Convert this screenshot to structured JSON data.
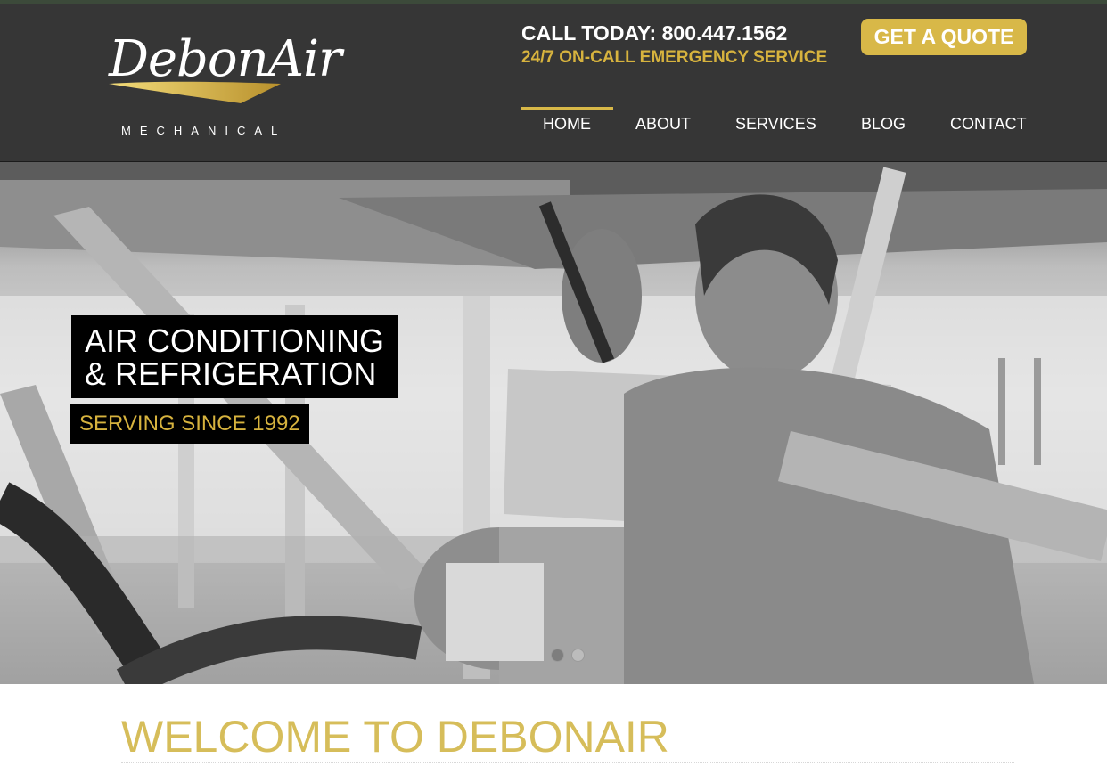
{
  "brand": {
    "logo_word": "DebonAir",
    "logo_sub": "MECHANICAL",
    "accent_color": "#d8b848",
    "header_bg": "#363636"
  },
  "header": {
    "call": "CALL TODAY: 800.447.1562",
    "emergency": "24/7 ON-CALL EMERGENCY SERVICE",
    "quote_button": "GET A QUOTE"
  },
  "nav": {
    "items": [
      {
        "label": "HOME",
        "active": true
      },
      {
        "label": "ABOUT",
        "active": false
      },
      {
        "label": "SERVICES",
        "active": false
      },
      {
        "label": "BLOG",
        "active": false
      },
      {
        "label": "CONTACT",
        "active": false
      }
    ]
  },
  "hero": {
    "headline_line1": "AIR CONDITIONING",
    "headline_line2": "& REFRIGERATION",
    "tagline": "SERVING SINCE 1992",
    "slide_count": 2,
    "active_slide": 1
  },
  "welcome": {
    "title": "WELCOME TO DEBONAIR"
  }
}
